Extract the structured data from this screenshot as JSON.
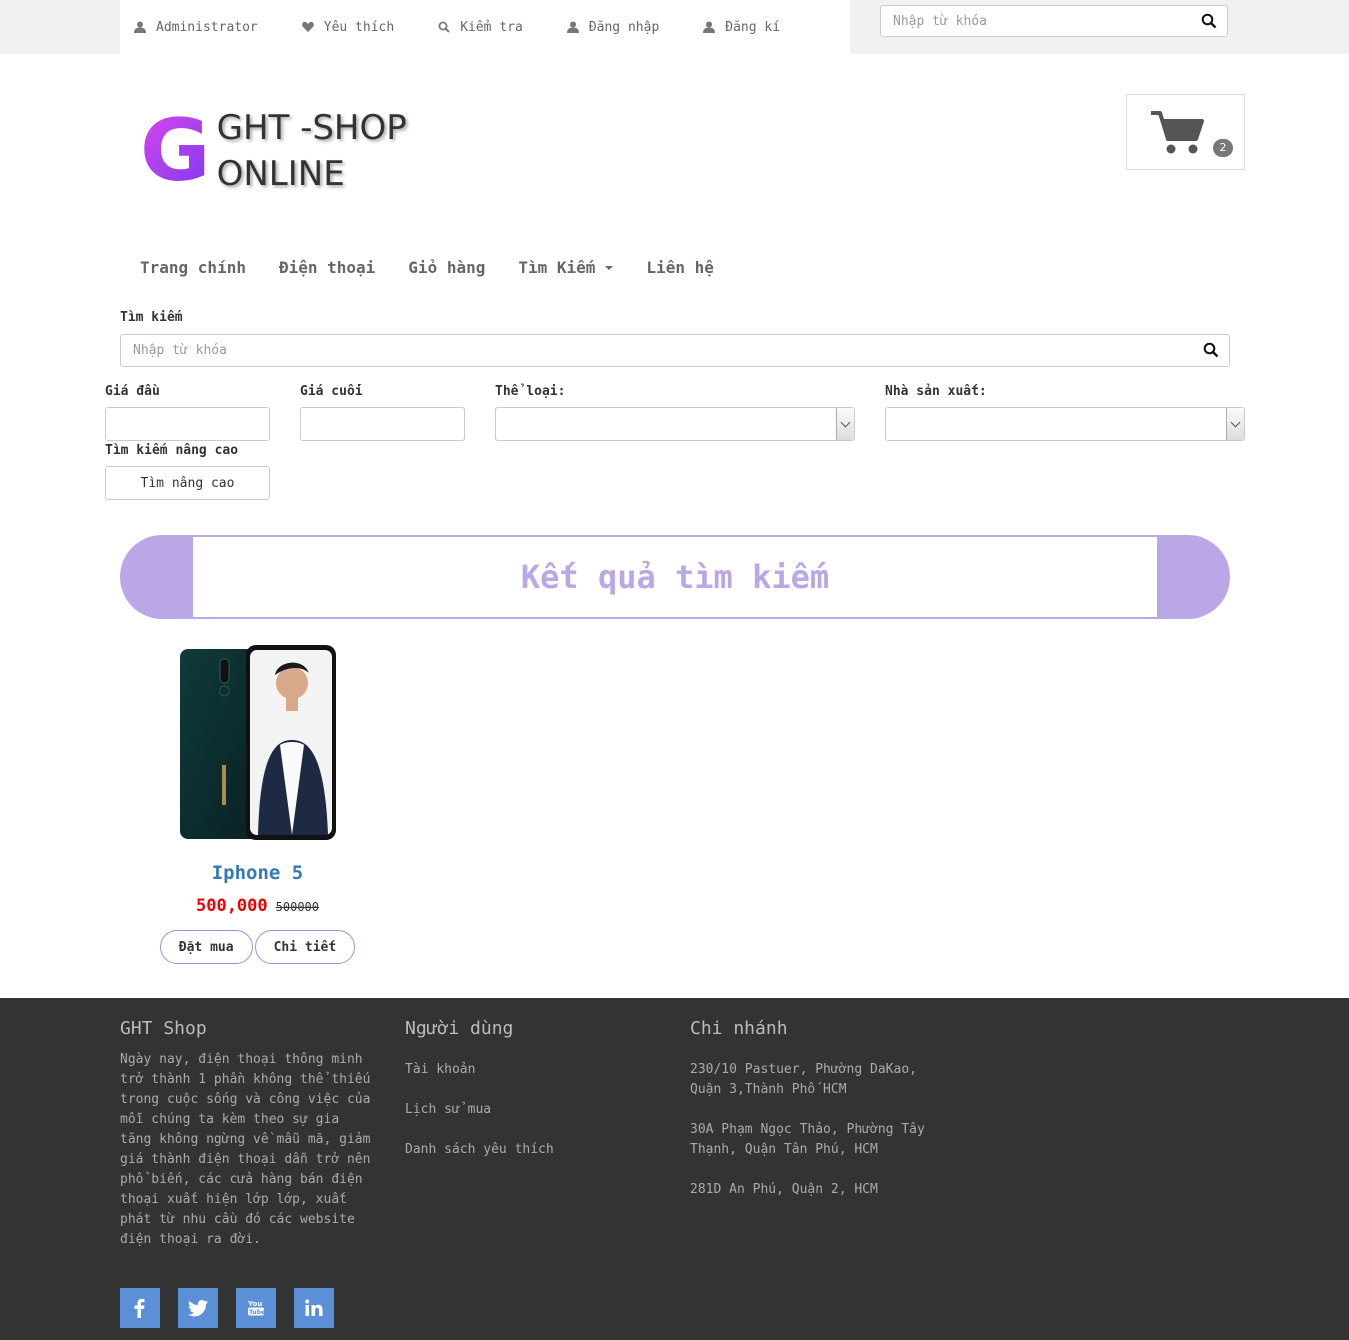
{
  "topbar": {
    "links": [
      "Administrator",
      "Yêu thích",
      "Kiểm tra",
      "Đăng nhập",
      "Đăng kí"
    ],
    "search_placeholder": "Nhập từ khóa"
  },
  "logo": {
    "letter": "G",
    "line1": "GHT -SHOP",
    "line2": "ONLINE"
  },
  "cart": {
    "count": "2"
  },
  "nav": {
    "items": [
      "Trang chính",
      "Điện thoại",
      "Giỏ hàng",
      "Tìm Kiếm",
      "Liên hệ"
    ]
  },
  "search_form": {
    "label": "Tìm kiếm",
    "placeholder": "Nhập từ khóa",
    "price_from_label": "Giá đầu",
    "price_to_label": "Giá cuối",
    "category_label": "Thể loại:",
    "manufacturer_label": "Nhà sản xuất:",
    "advanced_label": "Tìm kiếm nâng cao",
    "advanced_button": "Tìm nâng cao"
  },
  "results": {
    "title": "Kết quả tìm kiếm",
    "products": [
      {
        "name": "Iphone 5",
        "price": "500,000",
        "old_price": "500000",
        "buy_label": "Đặt mua",
        "detail_label": "Chi tiết"
      }
    ]
  },
  "footer": {
    "about": {
      "title": "GHT Shop",
      "text": "Ngày nay, điện thoại thông minh trở thành 1 phần không thể thiếu trong cuộc sống và công việc của mỗi chúng ta kèm theo sự gia tăng không ngừng về mẫu mã, giảm giá thành điện thoại dẫn trở nên phổ biến, các cửa hàng bán điện thoại xuất hiện lớp lớp, xuất phát từ nhu cầu đó các website điện thoại ra đời."
    },
    "user": {
      "title": "Người dùng",
      "links": [
        "Tài khoản",
        "Lịch sử mua",
        "Danh sách yêu thích"
      ]
    },
    "branches": {
      "title": "Chi nhánh",
      "addresses": [
        "230/10 Pastuer, Phường DaKao, Quận 3,Thành Phố HCM",
        "30A Phạm Ngọc Thảo, Phường Tây Thạnh, Quận Tân Phú, HCM",
        "281D An Phú, Quận 2, HCM"
      ]
    },
    "social": [
      "facebook-icon",
      "twitter-icon",
      "youtube-icon",
      "linkedin-icon"
    ],
    "social_color": "#5b8fd6"
  },
  "colors": {
    "accent": "#bba7e6",
    "price": "#e00000",
    "link": "#337ab7",
    "footer_bg": "#333333"
  }
}
